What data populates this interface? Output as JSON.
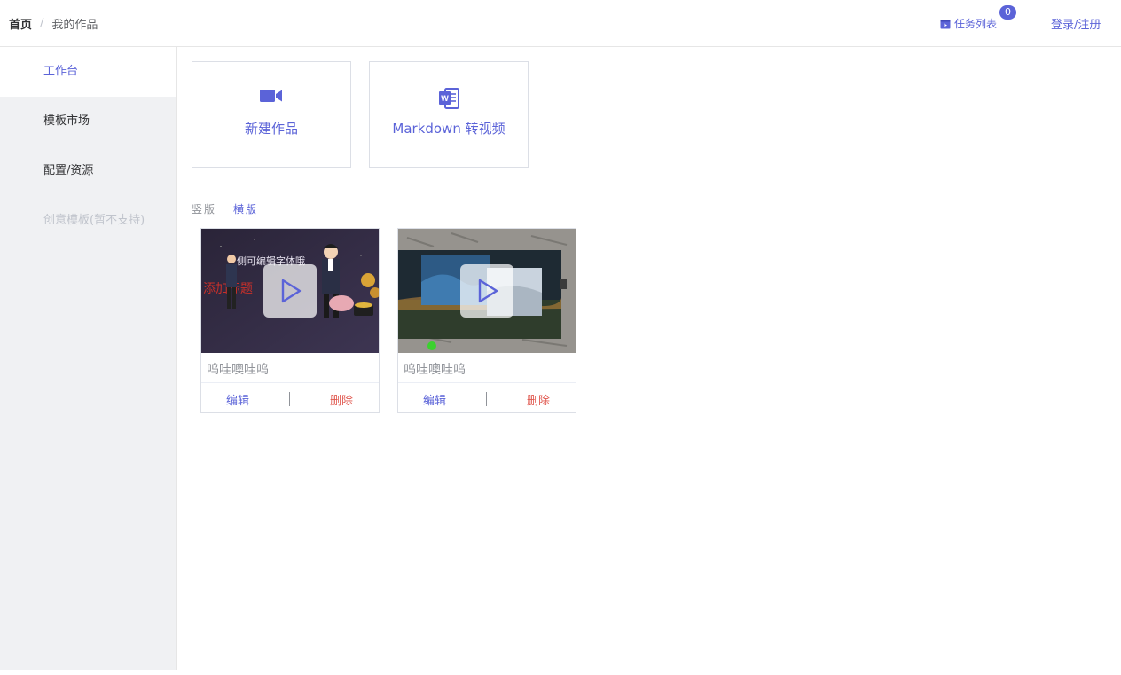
{
  "breadcrumb": {
    "home": "首页",
    "separator": "/",
    "current": "我的作品"
  },
  "header": {
    "tasks_label": "任务列表",
    "tasks_count": "0",
    "login_label": "登录/注册"
  },
  "sidebar": {
    "items": [
      {
        "label": "工作台",
        "state": "active"
      },
      {
        "label": "模板市场",
        "state": "normal"
      },
      {
        "label": "配置/资源",
        "state": "normal"
      },
      {
        "label": "创意模板(暂不支持)",
        "state": "disabled"
      }
    ]
  },
  "actions": {
    "new_work": {
      "label": "新建作品",
      "icon": "video-camera-icon"
    },
    "markdown": {
      "label": "Markdown 转视频",
      "icon": "word-document-icon"
    }
  },
  "orientation": {
    "vertical": "竖版",
    "horizontal": "横版",
    "selected": "横版"
  },
  "works": [
    {
      "title": "呜哇噢哇呜",
      "edit": "编辑",
      "delete": "删除",
      "thumbnail": "cartoon-business-scene",
      "overlay_text_1": "侧可编辑字体哦",
      "overlay_text_2": "添加标题"
    },
    {
      "title": "呜哇噢哇呜",
      "edit": "编辑",
      "delete": "删除",
      "thumbnail": "landscape-photo-collage",
      "overlay_text_1": "",
      "overlay_text_2": ""
    }
  ],
  "colors": {
    "accent": "#5b63d8",
    "danger": "#e0584f",
    "sidebar_bg": "#f0f1f3"
  }
}
